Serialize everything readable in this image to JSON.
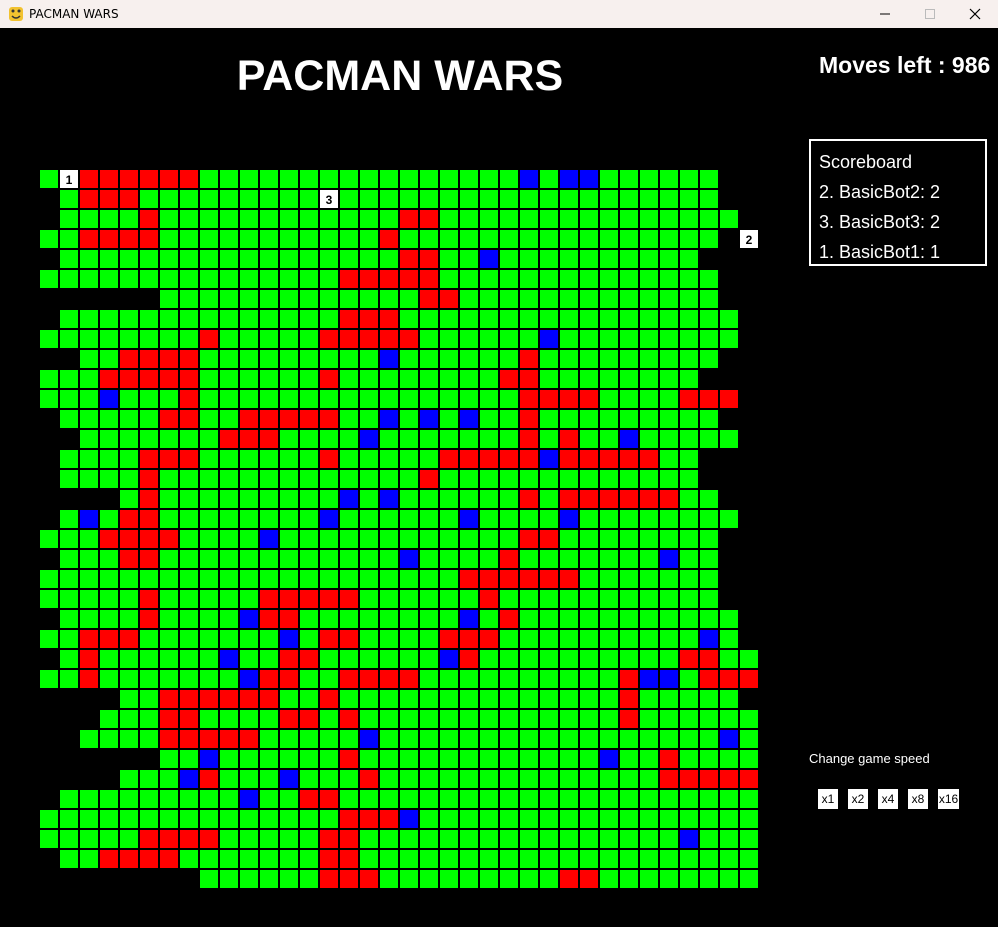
{
  "window": {
    "title": "PACMAN WARS"
  },
  "header": {
    "title": "PACMAN WARS",
    "moves_label": "Moves left : 986"
  },
  "scoreboard": {
    "title": "Scoreboard",
    "entries": [
      "2. BasicBot2: 2",
      "3. BasicBot3: 2",
      "1. BasicBot1: 1"
    ]
  },
  "speed": {
    "label": "Change game speed",
    "buttons": [
      "x1",
      "x2",
      "x4",
      "x8",
      "x16"
    ]
  },
  "colors": {
    "background": "#000000",
    "green": "#00ff00",
    "red": "#ff0000",
    "blue": "#0000ff",
    "cell_border": "#000000"
  },
  "legend": {
    "G": "green",
    "R": "red",
    "B": "blue",
    ".": "empty"
  },
  "board": {
    "rows": [
      "G.RRRRRRGGGGGGGGGGGGGGGGBGBBGGGGGG.",
      ".GRRRGGGGGGGGGGGGGGGGGGGGGGGGGGGGG.",
      ".GGGGRGGGGGGGGGGGGRRGGGGGGGGGGGGGGG",
      "GGRRRRGGGGGGGGGGGRGGGGGGGGGGGGGGGG.",
      ".GGGGGGGGGGGGGGGGGRRGGBGGGGGGGGGG..",
      "GGGGGGGGGGGGGGGRRRRRGGGGGGGGGGGGGG.",
      "......GGGGGGGGGGGGGRRGGGGGGGGGGGGG.",
      ".GGGGGGGGGGGGGGRRRGGGGGGGGGGGGGGGGG",
      "GGGGGGGGRGGGGGRRRRRGGGGGGBGGGGGGGGG",
      "..GGRRRRGGGGGGGGGBGGGGGGRGGGGGGGGG.",
      "GGGRRRRRGGGGGGRGGGGGGGGRRGGGGGGGG..",
      "GGGBGGGRGGGGGGGGGGGGGGGGRRRRGGGGRRR",
      ".GGGGGRRGGRRRRRGGBGBGBGGRGGGGGGGGG.",
      "..GGGGGGGRRRGGGGBGGGGGGGRGRGGBGGGGG",
      ".GGGGRRRGGGGGGRGGGGGRRRRRBRRRRRGG..",
      ".GGGGRGGGGGGGGGGGGGRGGGGGGGGGGGGG..",
      "....GRGGGGGGGGGBGBGGGGGGRGRRRRRRGG.",
      ".GBGRRGGGGGGGGBGGGGGGBGGGGBGGGGGGGG",
      "GGGRRRRGGGGBGGGGGGGGGGGGRRGGGGGGGG.",
      ".GGGRRGGGGGGGGGGGGBGGGGRGGGGGGGBGG.",
      "GGGGGGGGGGGGGGGGGGGGGRRRRRRGGGGGGG.",
      "GGGGGRGGGGGRRRRRGGGGGGRGGGGGGGGGGG.",
      ".GGGGRGGGGBRRGGGGGGGGBGRGGGGGGGGGGG",
      "GGRRRGGGGGGGBGRRGGGGRRRGGGGGGGGGGBG",
      ".GRGGGGGGBGGRRGGGGGGBRGGGGGGGGGGRRGG",
      "GGRGGGGGGGBRRGGRRRRGGGGGGGGGGRBBGRRRR",
      "....GGRRRRRRGGRGGGGGGGGGGGGGGRGGGGG..",
      "...GGGRRGGGGRRGRGGGGGGGGGGGGGRGGGGGG.",
      "..GGGGRRRRRGGGGGBGGGGGGGGGGGGGGGGGBGG",
      "......GGBGGGGGGRGGGGGGGGGGGGBGGRGGGGGGG",
      "....GGGBRGGGBGGGRGGGGGGGGGGGGGGRRRRRRRG",
      ".GGGGGGGGGBGGRRGGGGGGGGGGGGGGGGGGGGGG..",
      "GGGGGGGGGGGGGGGRRRBGGGGGGGGGGGGGGGGGGGG",
      "GGGGGRRRRGGGGGRRGGGGGGGGGGGGGGGGBGGGGG.",
      ".GGRRRRGGGGGGGRRGGGGGGGGGGGGGGGGGGGGGG.",
      "........GGGGGGRRRGGGGGGGGGRRGGGGGGGGGG."
    ],
    "markers": [
      {
        "label": "1",
        "row": 0,
        "col": 1
      },
      {
        "label": "3",
        "row": 1,
        "col": 14
      },
      {
        "label": "2",
        "row": 3,
        "col": 35
      }
    ]
  }
}
